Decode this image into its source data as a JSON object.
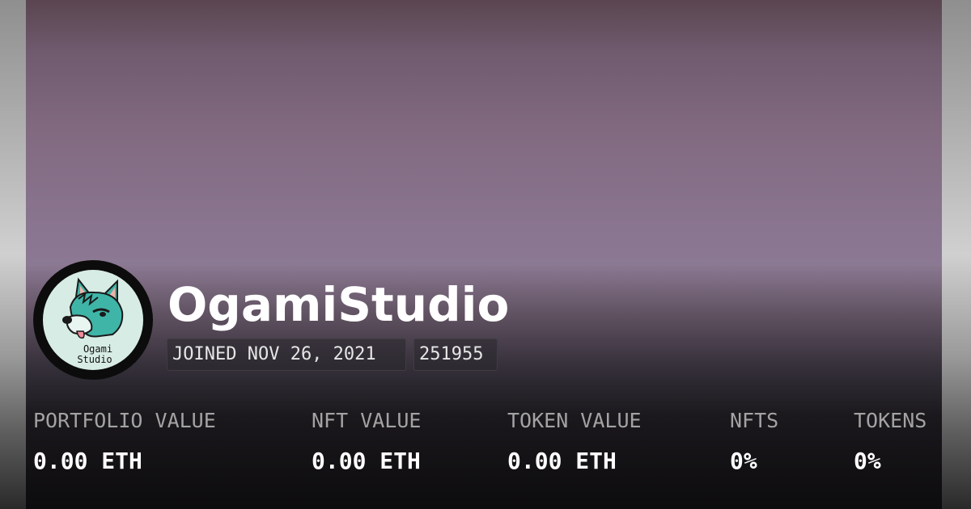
{
  "profile": {
    "name": "OgamiStudio",
    "avatar_logo_lines": [
      "Ogami",
      "Studio"
    ],
    "joined": "JOINED NOV 26, 2021",
    "id": "251955"
  },
  "stats": [
    {
      "label": "PORTFOLIO VALUE",
      "value": "0.00 ETH"
    },
    {
      "label": "NFT VALUE",
      "value": "0.00 ETH"
    },
    {
      "label": "TOKEN VALUE",
      "value": "0.00 ETH"
    },
    {
      "label": "NFTS",
      "value": "0%"
    },
    {
      "label": "TOKENS",
      "value": "0%"
    }
  ],
  "colors": {
    "banner_top": "#5a4550",
    "banner_mid": "#8b7892",
    "banner_bottom": "#0c0b0d",
    "avatar_bg": "#d7ece4",
    "wolf_teal": "#3fb5a8",
    "label_gray": "#a3a3a3",
    "value_white": "#ffffff"
  },
  "icons": {
    "avatar": "wolf-mascot-icon"
  }
}
